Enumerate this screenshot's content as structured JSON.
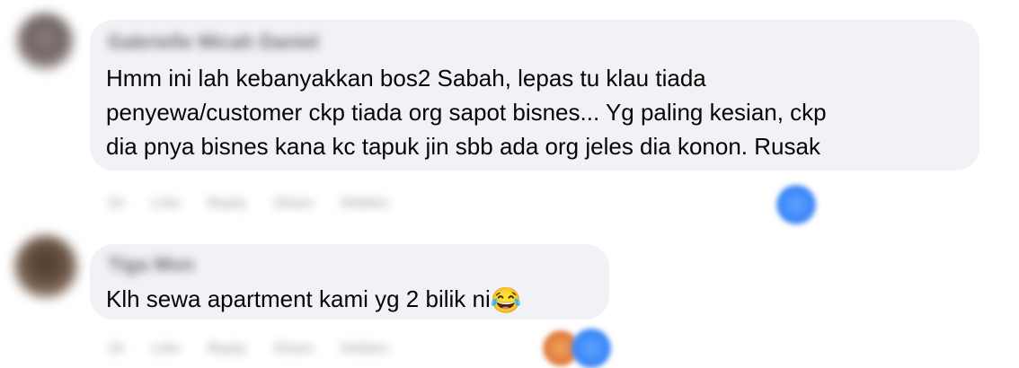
{
  "comments": [
    {
      "author": "Gabrielle Micah Daniel",
      "text_lines": [
        "Hmm ini lah kebanyakkan bos2 Sabah, lepas tu klau tiada",
        "penyewa/customer ckp tiada org sapot bisnes... Yg paling kesian, ckp",
        "dia pnya bisnes kana kc tapuk jin sbb ada org jeles dia konon. Rusak"
      ],
      "actions": [
        "1h",
        "Like",
        "Reply",
        "Share",
        "Hidden"
      ],
      "reaction_icon": "like-reaction-icon"
    },
    {
      "author": "Tiga Mon",
      "text": "Klh sewa apartment kami yg 2 bilik ni",
      "emoji": "😂",
      "actions": [
        "1h",
        "Like",
        "Reply",
        "Share",
        "Hidden"
      ],
      "reaction_icons": [
        "haha-reaction-icon",
        "like-reaction-icon"
      ]
    }
  ],
  "colors": {
    "bubble": "#f0f2f5",
    "text": "#050505",
    "meta": "#65676b",
    "like_blue": "#3b86f7"
  }
}
